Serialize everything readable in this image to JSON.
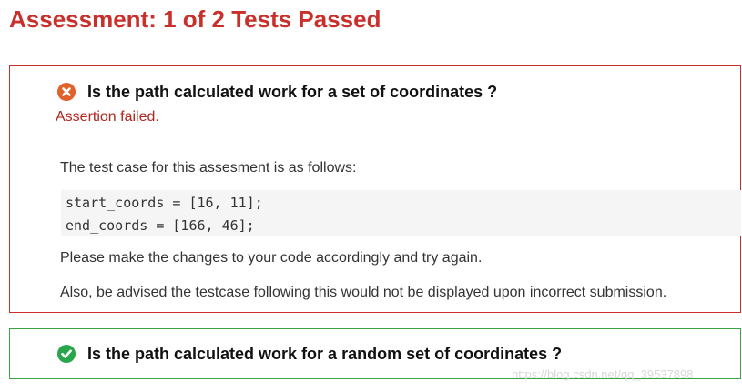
{
  "header": {
    "title": "Assessment: 1 of 2 Tests Passed"
  },
  "tests": [
    {
      "status": "failed",
      "status_icon": "x-circle-icon",
      "question": "Is the path calculated work for a set of coordinates ?",
      "message": "Assertion failed.",
      "intro": "The test case for this assesment is as follows:",
      "code_lines": [
        "start_coords = [16, 11];",
        "end_coords = [166, 46];"
      ],
      "advice": "Please make the changes to your code accordingly and try again.",
      "notice": "Also, be advised the testcase following this would not be displayed upon incorrect submission."
    },
    {
      "status": "passed",
      "status_icon": "check-circle-icon",
      "question": "Is the path calculated work for a random set of coordinates ?"
    }
  ],
  "watermark": "https://blog.csdn.net/qq_39537898",
  "colors": {
    "fail": "#c9302c",
    "pass": "#3ba545"
  }
}
